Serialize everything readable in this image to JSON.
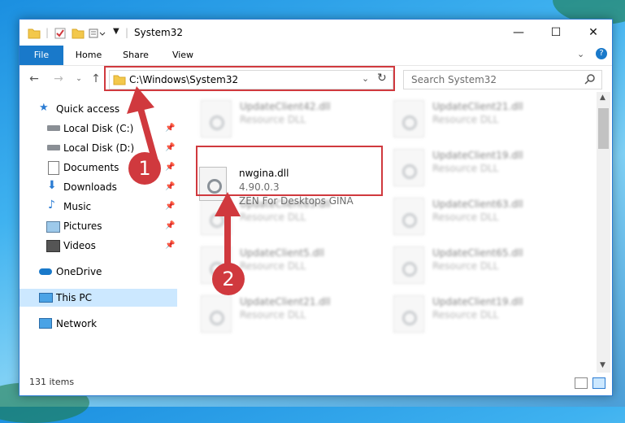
{
  "window": {
    "title": "System32"
  },
  "ribbon": {
    "tabs": [
      "File",
      "Home",
      "Share",
      "View"
    ]
  },
  "address": {
    "path": "C:\\Windows\\System32"
  },
  "search": {
    "placeholder": "Search System32"
  },
  "nav": {
    "quick_access": "Quick access",
    "items": [
      {
        "label": "Local Disk (C:)",
        "icon": "drive-icon"
      },
      {
        "label": "Local Disk (D:)",
        "icon": "drive-icon"
      },
      {
        "label": "Documents",
        "icon": "documents-icon"
      },
      {
        "label": "Downloads",
        "icon": "downloads-icon"
      },
      {
        "label": "Music",
        "icon": "music-icon"
      },
      {
        "label": "Pictures",
        "icon": "pictures-icon"
      },
      {
        "label": "Videos",
        "icon": "videos-icon"
      }
    ],
    "onedrive": "OneDrive",
    "this_pc": "This PC",
    "network": "Network"
  },
  "files": {
    "focus": {
      "name": "nwgina.dll",
      "version": "4.90.0.3",
      "description": "ZEN For Desktops GINA"
    },
    "left_column": [
      {
        "name": "UpdateClient42.dll",
        "type": "Resource DLL"
      },
      {
        "name": "UpdateClient63.dll",
        "type": "Resource DLL"
      },
      {
        "name": "UpdateClient5.dll",
        "type": "Resource DLL"
      },
      {
        "name": "UpdateClient21.dll",
        "type": "Resource DLL"
      }
    ],
    "right_column": [
      {
        "name": "UpdateClient21.dll",
        "type": "Resource DLL"
      },
      {
        "name": "UpdateClient19.dll",
        "type": "Resource DLL"
      },
      {
        "name": "UpdateClient63.dll",
        "type": "Resource DLL"
      },
      {
        "name": "UpdateClient65.dll",
        "type": "Resource DLL"
      },
      {
        "name": "UpdateClient19.dll",
        "type": "Resource DLL"
      }
    ]
  },
  "status": {
    "count": "131 items"
  },
  "annotations": {
    "step1": "1",
    "step2": "2",
    "color": "#d0393e"
  },
  "colors": {
    "accent": "#1979ca",
    "selection": "#cce8ff"
  }
}
